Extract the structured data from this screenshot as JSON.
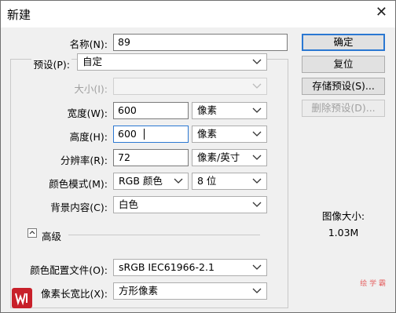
{
  "window": {
    "title": "新建",
    "close_glyph": "✕"
  },
  "form": {
    "name_label": "名称(N):",
    "name_value": "89",
    "preset_label": "预设(P):",
    "preset_value": "自定",
    "size_label": "大小(I):",
    "size_value": "",
    "width_label": "宽度(W):",
    "width_value": "600",
    "width_unit": "像素",
    "height_label": "高度(H):",
    "height_value": "600",
    "height_unit": "像素",
    "resolution_label": "分辨率(R):",
    "resolution_value": "72",
    "resolution_unit": "像素/英寸",
    "color_mode_label": "颜色模式(M):",
    "color_mode_value": "RGB 颜色",
    "bit_depth_value": "8 位",
    "background_label": "背景内容(C):",
    "background_value": "白色",
    "advanced_label": "高级",
    "color_profile_label": "颜色配置文件(O):",
    "color_profile_value": "sRGB IEC61966-2.1",
    "pixel_aspect_label": "像素长宽比(X):",
    "pixel_aspect_value": "方形像素"
  },
  "buttons": {
    "ok": "确定",
    "reset": "复位",
    "save_preset": "存储预设(S)...",
    "delete_preset": "删除预设(D)..."
  },
  "image_size": {
    "label": "图像大小:",
    "value": "1.03M"
  },
  "watermark": {
    "text": "绘 学 霸"
  },
  "colors": {
    "accent": "#2b78d2",
    "logo": "#c8202a"
  }
}
